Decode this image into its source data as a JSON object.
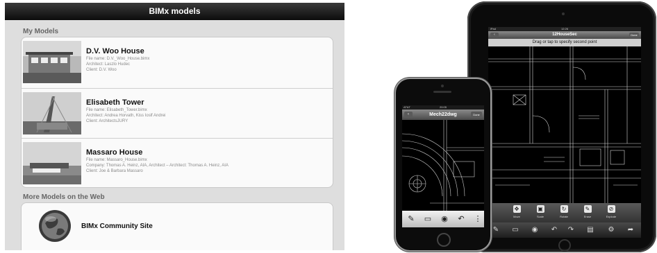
{
  "bimx": {
    "title": "BIMx models",
    "section_my_models": "My Models",
    "section_more": "More Models on the Web",
    "models": [
      {
        "name": "D.V. Woo House",
        "lines": [
          "File name: D.V._Woo_House.bimx",
          "Architect: Laszlo Hudec",
          "Client: D.V. Woo"
        ]
      },
      {
        "name": "Elisabeth Tower",
        "lines": [
          "File name: Elisabeth_Tower.bimx",
          "Architect: Andrea Horvath, Kiss Ioslf Andrei",
          "Client: ArchitectsJURY"
        ]
      },
      {
        "name": "Massaro House",
        "lines": [
          "File name: Massaro_House.bimx",
          "Company: Thomas A. Heinz, AIA, Architect – Architect: Thomas A. Heinz, AIA",
          "Client: Joe & Barbara Massaro"
        ]
      }
    ],
    "community": {
      "label": "BIMx Community Site",
      "icon": "globe-icon"
    }
  },
  "ipad": {
    "status_left": "iPad",
    "status_time": "12:26",
    "title": "12HouseSec",
    "done": "Done",
    "back_icon": "back-icon",
    "hint": "Drag or tap to specify second point",
    "tools": [
      {
        "label": "Move",
        "icon": "move-icon"
      },
      {
        "label": "Scale",
        "icon": "scale-icon"
      },
      {
        "label": "Rotate",
        "icon": "rotate-icon"
      },
      {
        "label": "Erase",
        "icon": "erase-icon"
      },
      {
        "label": "Explode",
        "icon": "explode-icon"
      }
    ],
    "bottom_icons": [
      "edit-icon",
      "comment-icon",
      "view-icon",
      "undo-icon",
      "redo-icon",
      "layers-icon",
      "tools-icon",
      "share-icon"
    ]
  },
  "iphone": {
    "status_left": "AT&T",
    "status_time": "20:05",
    "title": "Mech22dwg",
    "done": "Done",
    "back_icon": "back-icon",
    "toolbar_icons": [
      "edit-icon",
      "comment-icon",
      "view-icon",
      "undo-icon",
      "more-icon"
    ]
  },
  "colors": {
    "titlebar": "#111111",
    "panel_bg": "#dedede",
    "card_bg": "#fafafa",
    "device_body": "#0b0b0b"
  }
}
